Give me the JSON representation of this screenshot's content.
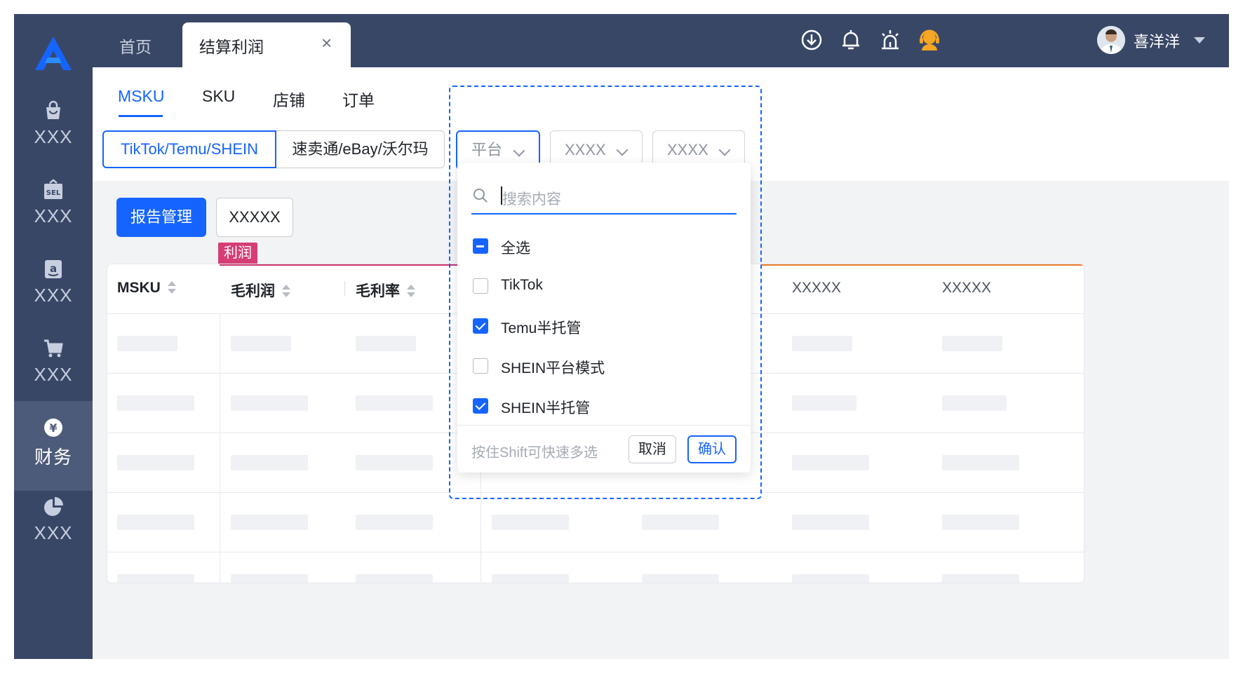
{
  "sidebar": {
    "items": [
      {
        "label": "XXX",
        "icon": "shopping-bag-icon"
      },
      {
        "label": "XXX",
        "icon": "sel-store-icon"
      },
      {
        "label": "XXX",
        "icon": "amazon-icon"
      },
      {
        "label": "XXX",
        "icon": "cart-icon"
      },
      {
        "label": "财务",
        "icon": "yen-icon",
        "active": true
      },
      {
        "label": "XXX",
        "icon": "pie-chart-icon"
      }
    ]
  },
  "header": {
    "tabs": [
      {
        "label": "首页"
      },
      {
        "label": "结算利润",
        "active": true,
        "close": "×"
      }
    ],
    "icons": [
      "download-icon",
      "bell-icon",
      "alarm-icon",
      "support-agent-icon"
    ],
    "user": {
      "name": "喜洋洋"
    }
  },
  "subtabs": [
    "MSKU",
    "SKU",
    "店铺",
    "订单"
  ],
  "filters": {
    "segment": [
      "TikTok/Temu/SHEIN",
      "速卖通/eBay/沃尔玛"
    ],
    "selects": [
      "平台",
      "XXXX",
      "XXXX"
    ]
  },
  "toolbar": {
    "report_button": "报告管理",
    "secondary_button": "XXXXX",
    "group_tag": "利润"
  },
  "table": {
    "columns": [
      "MSKU",
      "毛利润",
      "毛利率",
      "XXXXX",
      "XXXXX"
    ]
  },
  "dropdown": {
    "search_placeholder": "搜索内容",
    "options": [
      {
        "label": "全选",
        "state": "indeterminate"
      },
      {
        "label": "TikTok",
        "state": "unchecked"
      },
      {
        "label": "Temu半托管",
        "state": "checked"
      },
      {
        "label": "SHEIN平台模式",
        "state": "unchecked"
      },
      {
        "label": "SHEIN半托管",
        "state": "checked"
      }
    ],
    "hint": "按住Shift可快速多选",
    "cancel": "取消",
    "confirm": "确认"
  },
  "colors": {
    "sidebar_bg": "#394767",
    "primary": "#1664ff",
    "profit_tag": "#d63d76",
    "group_orange": "#e8792a"
  }
}
